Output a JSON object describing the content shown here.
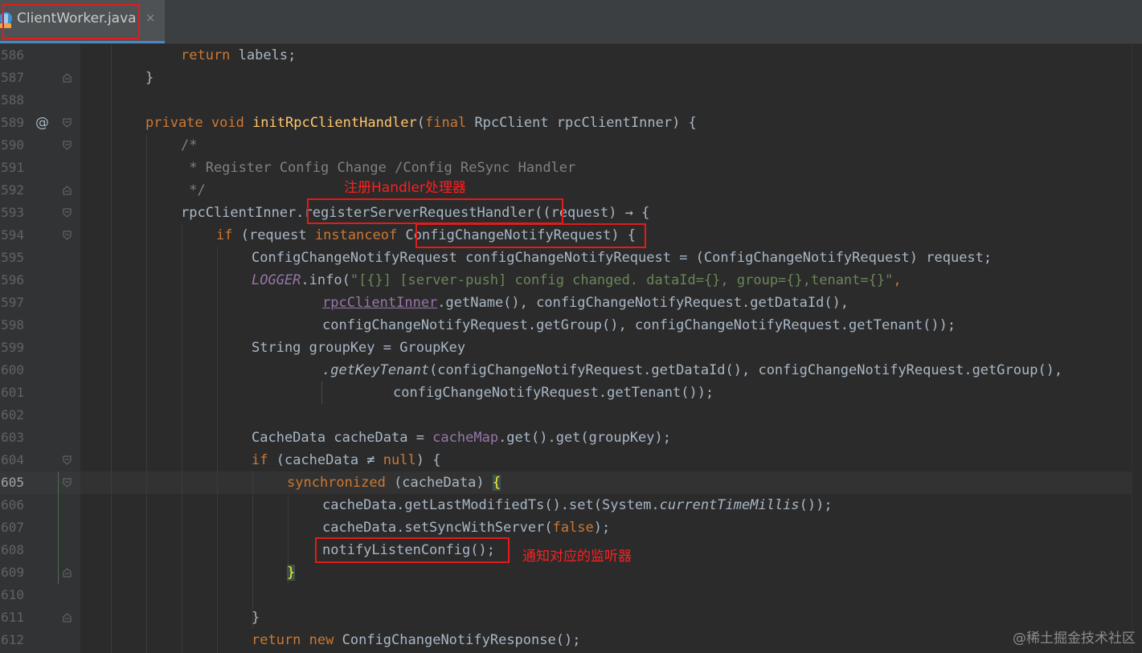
{
  "tab": {
    "filename": "ClientWorker.java",
    "close": "×"
  },
  "annotations": {
    "register_handler": "注册Handler处理器",
    "notify_listener": "通知对应的监听器"
  },
  "watermark": "@稀土掘金技术社区",
  "gutter": {
    "override_marker": "@",
    "line_numbers": [
      "586",
      "587",
      "588",
      "589",
      "590",
      "591",
      "592",
      "593",
      "594",
      "595",
      "596",
      "597",
      "598",
      "599",
      "600",
      "601",
      "602",
      "603",
      "604",
      "605",
      "606",
      "607",
      "608",
      "609",
      "610",
      "611",
      "612"
    ],
    "current_line": "605"
  },
  "code": {
    "l586": {
      "kw": "return",
      "t": " labels;"
    },
    "l587": {
      "t": "}"
    },
    "l589": {
      "kw1": "private void ",
      "fn": "initRpcClientHandler",
      "t1": "(",
      "kw2": "final",
      "t2": " RpcClient rpcClientInner) {"
    },
    "l590": {
      "c": "/*"
    },
    "l591": {
      "c": " * Register Config Change /Config ReSync Handler"
    },
    "l592": {
      "c": " */"
    },
    "l593": {
      "t1": "rpcClientInner.",
      "m": "registerServerRequestHandler",
      "t2": "((request) → {"
    },
    "l594": {
      "kw1": "if",
      "t1": " (request ",
      "kw2": "instanceof",
      "t2": " ",
      "cls": "ConfigChangeNotifyRequest",
      "t3": ") {"
    },
    "l595": {
      "t": "ConfigChangeNotifyRequest configChangeNotifyRequest = (ConfigChangeNotifyRequest) request;"
    },
    "l596": {
      "st": "LOGGER",
      "t1": ".info(",
      "s": "\"[{}] [server-push] config changed. dataId={}, group={},tenant={}\"",
      "t2": ","
    },
    "l597": {
      "f": "rpcClientInner",
      "t": ".getName(), configChangeNotifyRequest.getDataId(),"
    },
    "l598": {
      "t": "configChangeNotifyRequest.getGroup(), configChangeNotifyRequest.getTenant());"
    },
    "l599": {
      "t": "String groupKey = GroupKey"
    },
    "l600": {
      "i": ".getKeyTenant",
      "t": "(configChangeNotifyRequest.getDataId(), configChangeNotifyRequest.getGroup(),"
    },
    "l601": {
      "t": "configChangeNotifyRequest.getTenant());"
    },
    "l603": {
      "t1": "CacheData cacheData = ",
      "f": "cacheMap",
      "t2": ".get().get(groupKey);"
    },
    "l604": {
      "kw1": "if",
      "t1": " (cacheData ≠ ",
      "kw2": "null",
      "t2": ") {"
    },
    "l605": {
      "kw": "synchronized",
      "t": " (cacheData) ",
      "b": "{"
    },
    "l606": {
      "t1": "cacheData.getLastModifiedTs().set(System.",
      "i": "currentTimeMillis",
      "t2": "());"
    },
    "l607": {
      "t1": "cacheData.setSyncWithServer(",
      "kw": "false",
      "t2": ");"
    },
    "l608": {
      "t": "notifyListenConfig();"
    },
    "l609": {
      "b": "}"
    },
    "l611": {
      "t": "}"
    },
    "l612": {
      "kw1": "return",
      "t1": " ",
      "kw2": "new",
      "t2": " ConfigChangeNotifyResponse();"
    }
  },
  "colors": {
    "background": "#2b2b2b",
    "gutter": "#313335",
    "keyword": "#cc7832",
    "method_decl": "#ffc66d",
    "string": "#6a8759",
    "comment": "#808080",
    "field": "#9876aa",
    "highlight_box": "#e21b1b"
  }
}
